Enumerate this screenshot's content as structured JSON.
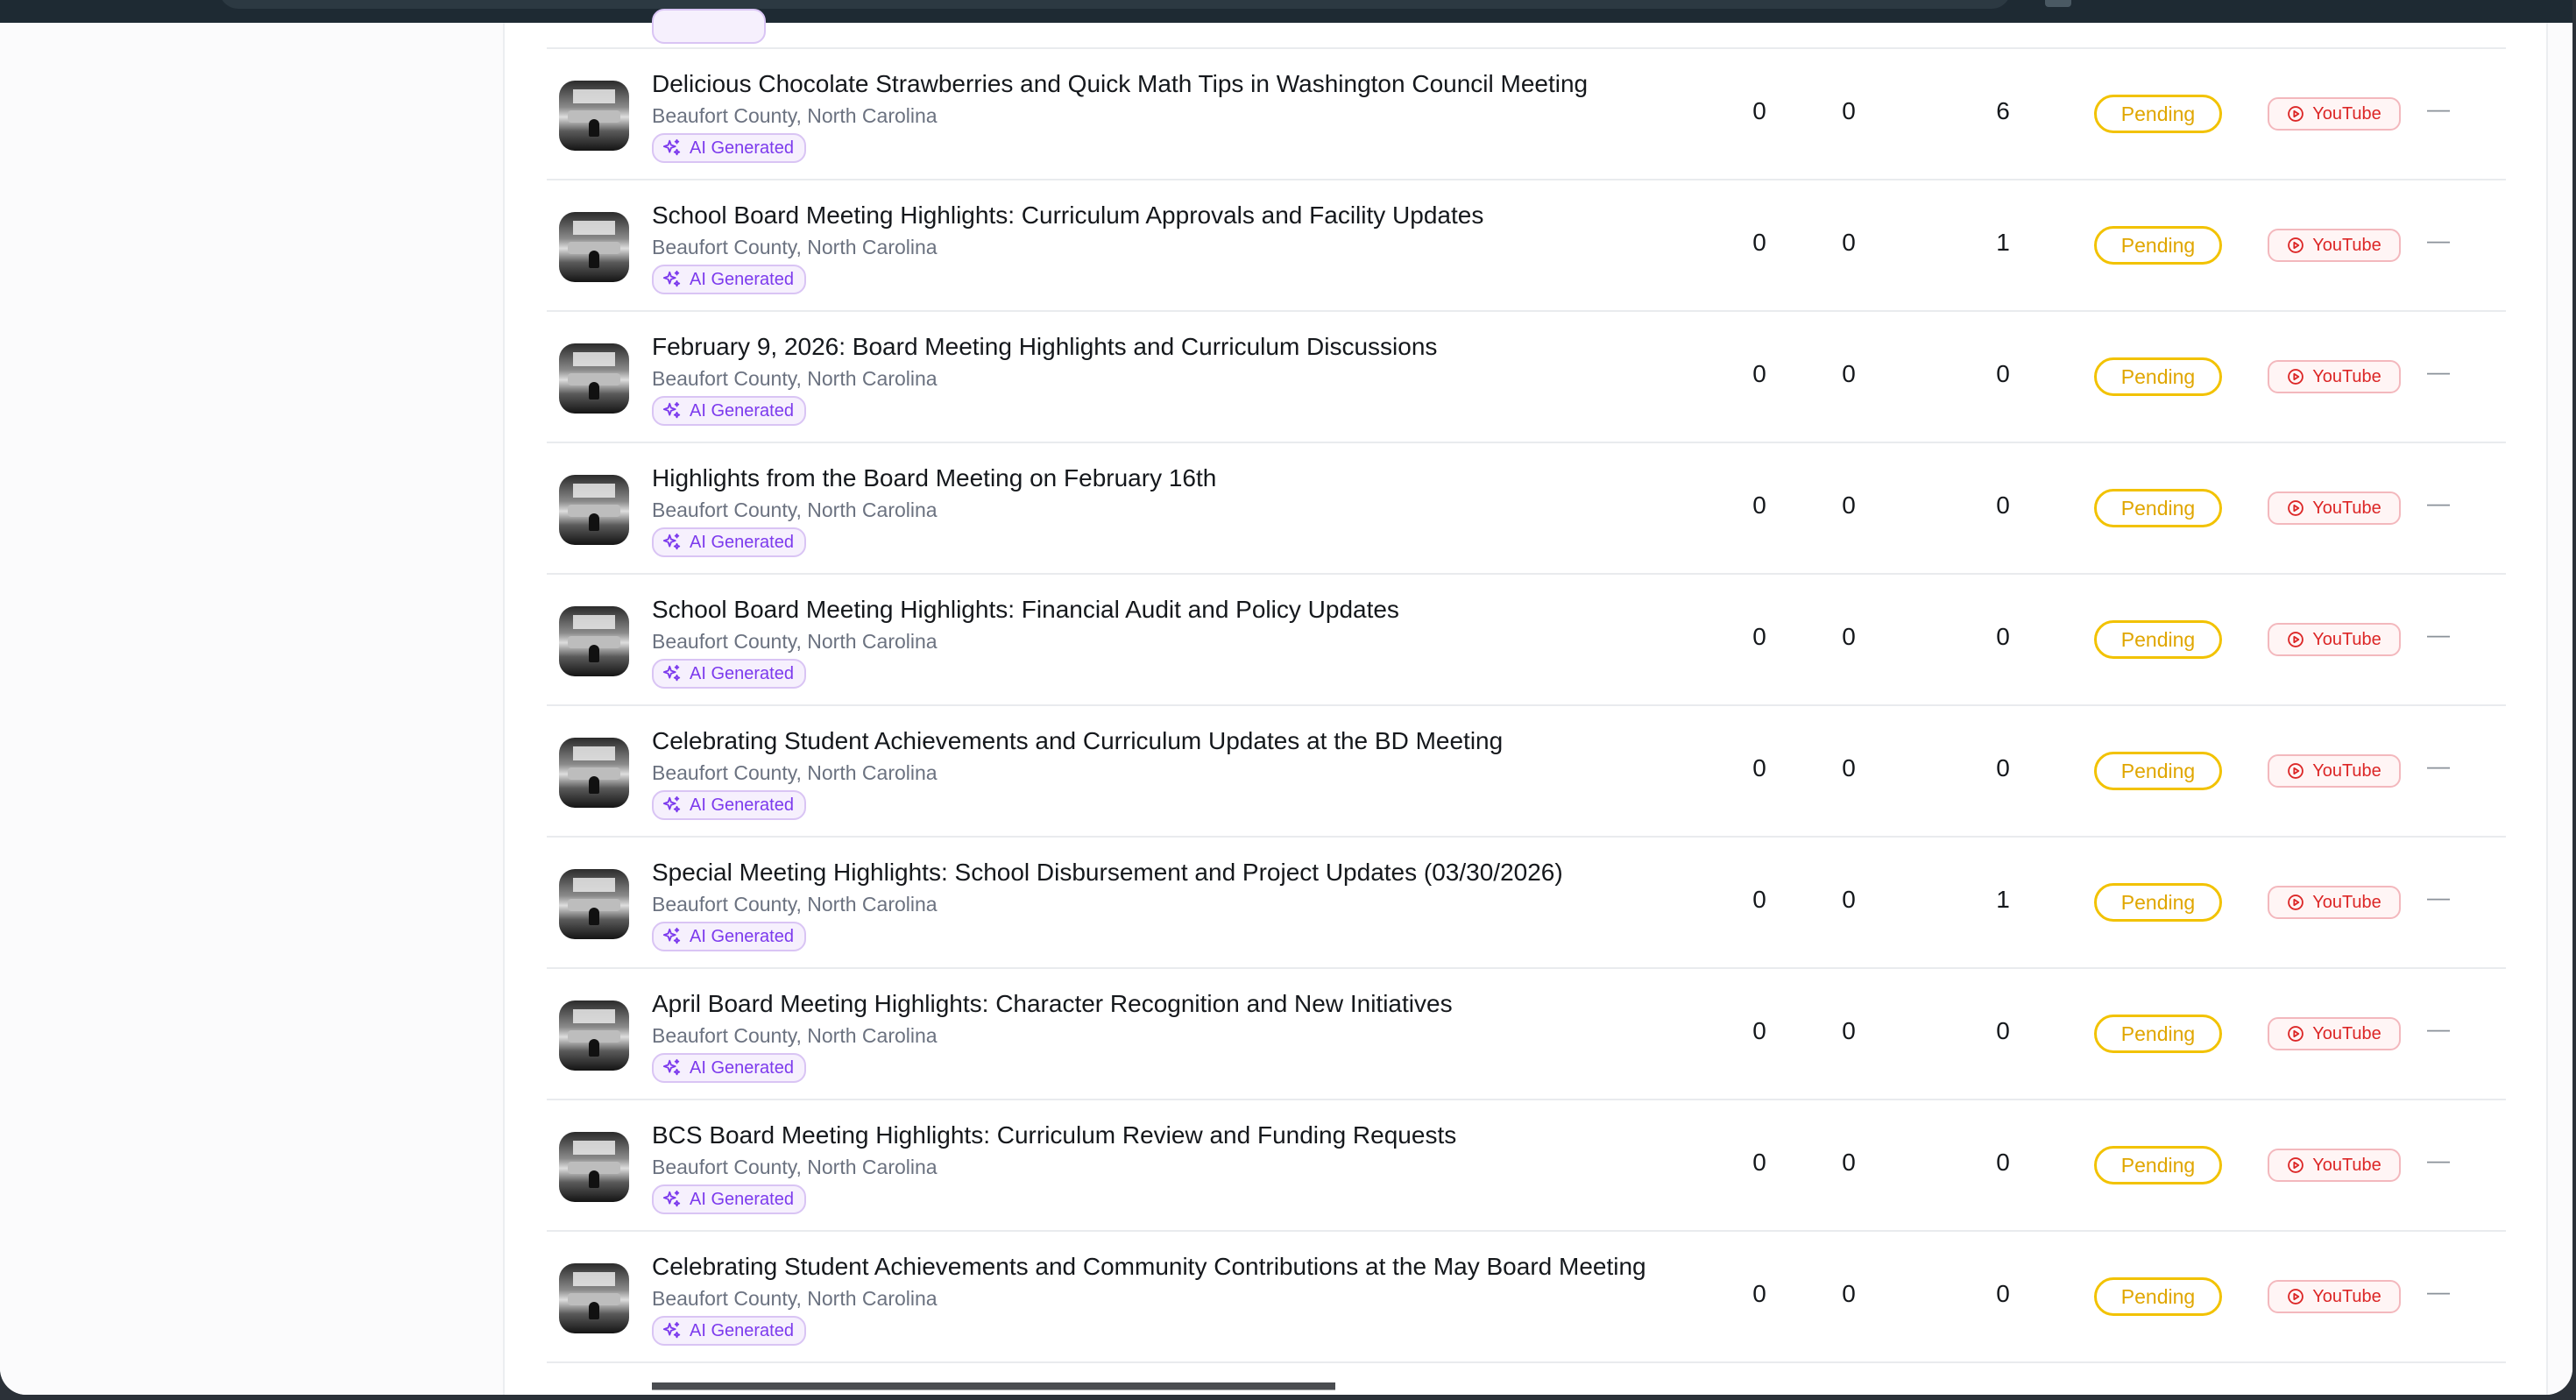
{
  "status_color": "#f2c200",
  "youtube_color": "#dc2626",
  "ai_badge_color": "#7c3aed",
  "meetings": [
    {
      "title": "Delicious Chocolate Strawberries and Quick Math Tips in Washington Council Meeting",
      "location": "Beaufort County, North Carolina",
      "badge": "AI Generated",
      "col1": "0",
      "col2": "0",
      "col3": "6",
      "status": "Pending",
      "source": "YouTube",
      "extra": "—"
    },
    {
      "title": "School Board Meeting Highlights: Curriculum Approvals and Facility Updates",
      "location": "Beaufort County, North Carolina",
      "badge": "AI Generated",
      "col1": "0",
      "col2": "0",
      "col3": "1",
      "status": "Pending",
      "source": "YouTube",
      "extra": "—"
    },
    {
      "title": "February 9, 2026: Board Meeting Highlights and Curriculum Discussions",
      "location": "Beaufort County, North Carolina",
      "badge": "AI Generated",
      "col1": "0",
      "col2": "0",
      "col3": "0",
      "status": "Pending",
      "source": "YouTube",
      "extra": "—"
    },
    {
      "title": "Highlights from the Board Meeting on February 16th",
      "location": "Beaufort County, North Carolina",
      "badge": "AI Generated",
      "col1": "0",
      "col2": "0",
      "col3": "0",
      "status": "Pending",
      "source": "YouTube",
      "extra": "—"
    },
    {
      "title": "School Board Meeting Highlights: Financial Audit and Policy Updates",
      "location": "Beaufort County, North Carolina",
      "badge": "AI Generated",
      "col1": "0",
      "col2": "0",
      "col3": "0",
      "status": "Pending",
      "source": "YouTube",
      "extra": "—"
    },
    {
      "title": "Celebrating Student Achievements and Curriculum Updates at the BD Meeting",
      "location": "Beaufort County, North Carolina",
      "badge": "AI Generated",
      "col1": "0",
      "col2": "0",
      "col3": "0",
      "status": "Pending",
      "source": "YouTube",
      "extra": "—"
    },
    {
      "title": "Special Meeting Highlights: School Disbursement and Project Updates (03/30/2026)",
      "location": "Beaufort County, North Carolina",
      "badge": "AI Generated",
      "col1": "0",
      "col2": "0",
      "col3": "1",
      "status": "Pending",
      "source": "YouTube",
      "extra": "—"
    },
    {
      "title": "April Board Meeting Highlights: Character Recognition and New Initiatives",
      "location": "Beaufort County, North Carolina",
      "badge": "AI Generated",
      "col1": "0",
      "col2": "0",
      "col3": "0",
      "status": "Pending",
      "source": "YouTube",
      "extra": "—"
    },
    {
      "title": "BCS Board Meeting Highlights: Curriculum Review and Funding Requests",
      "location": "Beaufort County, North Carolina",
      "badge": "AI Generated",
      "col1": "0",
      "col2": "0",
      "col3": "0",
      "status": "Pending",
      "source": "YouTube",
      "extra": "—"
    },
    {
      "title": "Celebrating Student Achievements and Community Contributions at the May Board Meeting",
      "location": "Beaufort County, North Carolina",
      "badge": "AI Generated",
      "col1": "0",
      "col2": "0",
      "col3": "0",
      "status": "Pending",
      "source": "YouTube",
      "extra": "—"
    }
  ]
}
